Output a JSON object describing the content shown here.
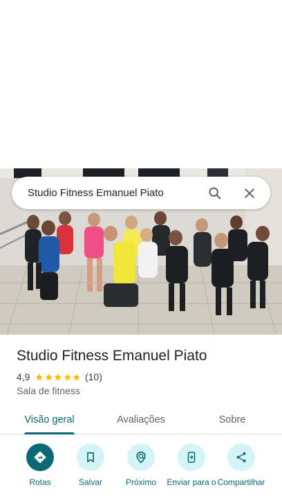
{
  "search": {
    "query": "Studio Fitness Emanuel Piato",
    "search_icon": "search-icon",
    "close_icon": "close-icon"
  },
  "place": {
    "name": "Studio Fitness Emanuel Piato",
    "rating": "4,9",
    "rating_value": 4.9,
    "review_count": "(10)",
    "category": "Sala de fitness",
    "star_color": "#fbbc04"
  },
  "tabs": [
    {
      "label": "Visão geral",
      "active": true
    },
    {
      "label": "Avaliações",
      "active": false
    },
    {
      "label": "Sobre",
      "active": false
    }
  ],
  "actions": [
    {
      "label": "Rotas",
      "icon": "directions-icon"
    },
    {
      "label": "Salvar",
      "icon": "bookmark-icon"
    },
    {
      "label": "Próximo",
      "icon": "nearby-icon"
    },
    {
      "label": "Enviar para o",
      "icon": "send-to-phone-icon"
    },
    {
      "label": "Compartilhar",
      "icon": "share-icon"
    }
  ],
  "colors": {
    "accent": "#0b6875",
    "accent_light": "#d5f4f7",
    "text_primary": "#202124",
    "text_secondary": "#5f6368"
  }
}
